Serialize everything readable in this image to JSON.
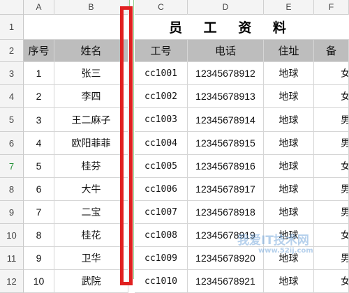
{
  "columns": [
    "A",
    "B",
    "C",
    "D",
    "E",
    "F"
  ],
  "title": "员 工 资 料",
  "headers": [
    "序号",
    "姓名",
    "工号",
    "电话",
    "住址",
    "备"
  ],
  "row_numbers": [
    "1",
    "2",
    "3",
    "4",
    "5",
    "6",
    "7",
    "8",
    "9",
    "10",
    "11",
    "12"
  ],
  "active_row": "7",
  "rows": [
    {
      "seq": "1",
      "name": "张三",
      "id": "cc1001",
      "phone": "12345678912",
      "addr": "地球",
      "note": "女"
    },
    {
      "seq": "2",
      "name": "李四",
      "id": "cc1002",
      "phone": "12345678913",
      "addr": "地球",
      "note": "女"
    },
    {
      "seq": "3",
      "name": "王二麻子",
      "id": "cc1003",
      "phone": "12345678914",
      "addr": "地球",
      "note": "男"
    },
    {
      "seq": "4",
      "name": "欧阳菲菲",
      "id": "cc1004",
      "phone": "12345678915",
      "addr": "地球",
      "note": "男"
    },
    {
      "seq": "5",
      "name": "桂芬",
      "id": "cc1005",
      "phone": "12345678916",
      "addr": "地球",
      "note": "女"
    },
    {
      "seq": "6",
      "name": "大牛",
      "id": "cc1006",
      "phone": "12345678917",
      "addr": "地球",
      "note": "男"
    },
    {
      "seq": "7",
      "name": "二宝",
      "id": "cc1007",
      "phone": "12345678918",
      "addr": "地球",
      "note": "男"
    },
    {
      "seq": "8",
      "name": "桂花",
      "id": "cc1008",
      "phone": "12345678919",
      "addr": "地球",
      "note": "女"
    },
    {
      "seq": "9",
      "name": "卫华",
      "id": "cc1009",
      "phone": "12345678920",
      "addr": "地球",
      "note": "男"
    },
    {
      "seq": "10",
      "name": "武院",
      "id": "cc1010",
      "phone": "12345678921",
      "addr": "地球",
      "note": "女"
    }
  ],
  "watermark": {
    "main": "我爱IT技术网",
    "sub": "www.52ij.com"
  },
  "colors": {
    "header_fill": "#bdbdbd",
    "highlight": "#e02020",
    "active_row": "#1f8f33"
  }
}
